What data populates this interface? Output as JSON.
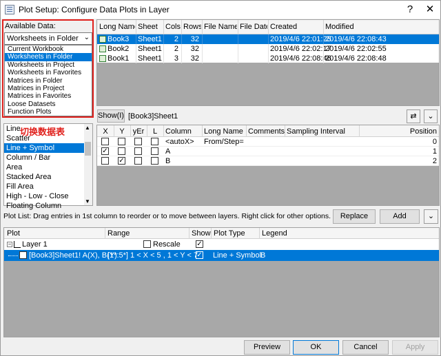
{
  "window": {
    "title": "Plot Setup: Configure Data Plots in Layer",
    "help": "?",
    "close": "✕"
  },
  "available": {
    "label": "Available Data:",
    "selected": "Worksheets in Folder",
    "options": [
      "Current Workbook",
      "Worksheets in Folder",
      "Worksheets in Project",
      "Worksheets in Favorites",
      "Matrices in Folder",
      "Matrices in Project",
      "Matrices in Favorites",
      "Loose Datasets",
      "Function Plots"
    ],
    "annotation": "切换数据表"
  },
  "book_table": {
    "headers": [
      "Long Name",
      "Sheet",
      "Cols",
      "Rows",
      "File Name",
      "File Date",
      "Created",
      "Modified"
    ],
    "rows": [
      [
        "Book3",
        "Sheet1",
        "2",
        "32",
        "",
        "",
        "2019/4/6 22:01:25",
        "2019/4/6 22:08:43"
      ],
      [
        "Book2",
        "Sheet1",
        "2",
        "32",
        "",
        "",
        "2019/4/6 22:02:17",
        "2019/4/6 22:02:55"
      ],
      [
        "Book1",
        "Sheet1",
        "3",
        "32",
        "",
        "",
        "2019/4/6 22:08:46",
        "2019/4/6 22:08:48"
      ]
    ]
  },
  "plot_types": {
    "items": [
      "Line",
      "Scatter",
      "Line + Symbol",
      "Column / Bar",
      "Area",
      "Stacked Area",
      "Fill Area",
      "High - Low - Close",
      "Floating Column"
    ],
    "selected_index": 2
  },
  "show_bar": {
    "show_button": "Show(I)",
    "sheet_label": "[Book3]Sheet1",
    "swap_icon": "⇄",
    "expand_icon": "⌄"
  },
  "column_table": {
    "headers": [
      "X",
      "Y",
      "yEr",
      "L",
      "Column",
      "Long Name",
      "Comments",
      "Sampling Interval",
      "Position"
    ],
    "rows": [
      {
        "x": false,
        "y": false,
        "yer": false,
        "l": false,
        "column": "<autoX>",
        "long_name": "From/Step=",
        "position": "0"
      },
      {
        "x": true,
        "y": false,
        "yer": false,
        "l": false,
        "column": "A",
        "long_name": "",
        "position": "1"
      },
      {
        "x": false,
        "y": true,
        "yer": false,
        "l": false,
        "column": "B",
        "long_name": "",
        "position": "2"
      }
    ]
  },
  "plot_list": {
    "hint": "Plot List: Drag entries in 1st column to reorder or to move between layers. Right click for other options.",
    "replace": "Replace",
    "add": "Add",
    "headers": [
      "Plot",
      "Range",
      "Show",
      "Plot Type",
      "Legend"
    ],
    "layer": {
      "label": "Layer 1",
      "rescale": "Rescale",
      "show": true
    },
    "plot": {
      "name": "[Book3]Sheet1! A(X), B(Y)",
      "range": "[1*:5*]  1 < X < 5 , 1 < Y < 7",
      "show": true,
      "type": "Line + Symbol",
      "legend": "B"
    }
  },
  "footer": {
    "preview": "Preview",
    "ok": "OK",
    "cancel": "Cancel",
    "apply": "Apply"
  },
  "colors": {
    "selection": "#0078d7",
    "annotation": "#e0201c"
  }
}
